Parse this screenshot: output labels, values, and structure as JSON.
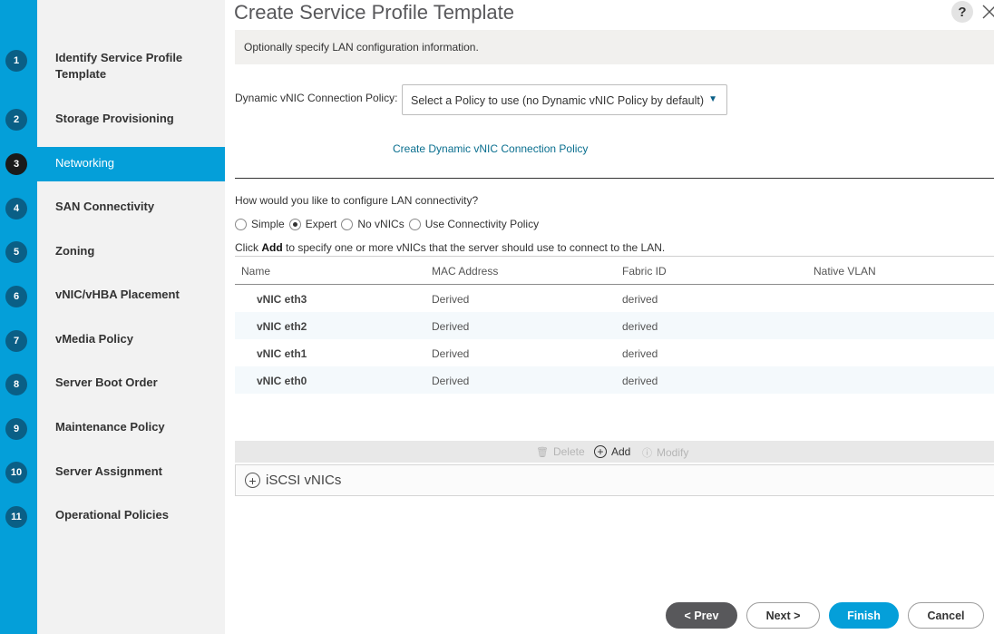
{
  "wizard": {
    "title": "Create Service Profile Template",
    "help_symbol": "?",
    "steps": [
      {
        "number": "1",
        "label": "Identify Service Profile Template",
        "active": false
      },
      {
        "number": "2",
        "label": "Storage Provisioning",
        "active": false
      },
      {
        "number": "3",
        "label": "Networking",
        "active": true
      },
      {
        "number": "4",
        "label": "SAN Connectivity",
        "active": false
      },
      {
        "number": "5",
        "label": "Zoning",
        "active": false
      },
      {
        "number": "6",
        "label": "vNIC/vHBA Placement",
        "active": false
      },
      {
        "number": "7",
        "label": "vMedia Policy",
        "active": false
      },
      {
        "number": "8",
        "label": "Server Boot Order",
        "active": false
      },
      {
        "number": "9",
        "label": "Maintenance Policy",
        "active": false
      },
      {
        "number": "10",
        "label": "Server Assignment",
        "active": false
      },
      {
        "number": "11",
        "label": "Operational Policies",
        "active": false
      }
    ]
  },
  "networking": {
    "banner": "Optionally specify LAN configuration information.",
    "dynamic_policy_label": "Dynamic vNIC Connection Policy:",
    "dynamic_policy_value": "Select a Policy to use (no Dynamic vNIC Policy by default)",
    "create_policy_link": "Create Dynamic vNIC Connection Policy",
    "question": "How would you like to configure LAN connectivity?",
    "options": [
      {
        "label": "Simple",
        "checked": false
      },
      {
        "label": "Expert",
        "checked": true
      },
      {
        "label": "No vNICs",
        "checked": false
      },
      {
        "label": "Use Connectivity Policy",
        "checked": false
      }
    ],
    "instruction_prefix": "Click ",
    "instruction_bold": "Add",
    "instruction_suffix": " to specify one or more vNICs that the server should use to connect to the LAN."
  },
  "table": {
    "columns": [
      "Name",
      "MAC Address",
      "Fabric ID",
      "Native VLAN"
    ],
    "rows": [
      {
        "name": "vNIC eth3",
        "mac": "Derived",
        "fabric": "derived",
        "vlan": ""
      },
      {
        "name": "vNIC eth2",
        "mac": "Derived",
        "fabric": "derived",
        "vlan": ""
      },
      {
        "name": "vNIC eth1",
        "mac": "Derived",
        "fabric": "derived",
        "vlan": ""
      },
      {
        "name": "vNIC eth0",
        "mac": "Derived",
        "fabric": "derived",
        "vlan": ""
      }
    ]
  },
  "toolbar": {
    "delete_label": "Delete",
    "add_label": "Add",
    "modify_label": "Modify"
  },
  "iscsi": {
    "label": "iSCSI vNICs"
  },
  "footer": {
    "prev_label": "< Prev",
    "next_label": "Next >",
    "finish_label": "Finish",
    "cancel_label": "Cancel"
  },
  "colors": {
    "accent": "#049fd9",
    "rail": "#049fd9",
    "step_badge": "#0a5f86",
    "active_badge": "#1a1a1a"
  }
}
